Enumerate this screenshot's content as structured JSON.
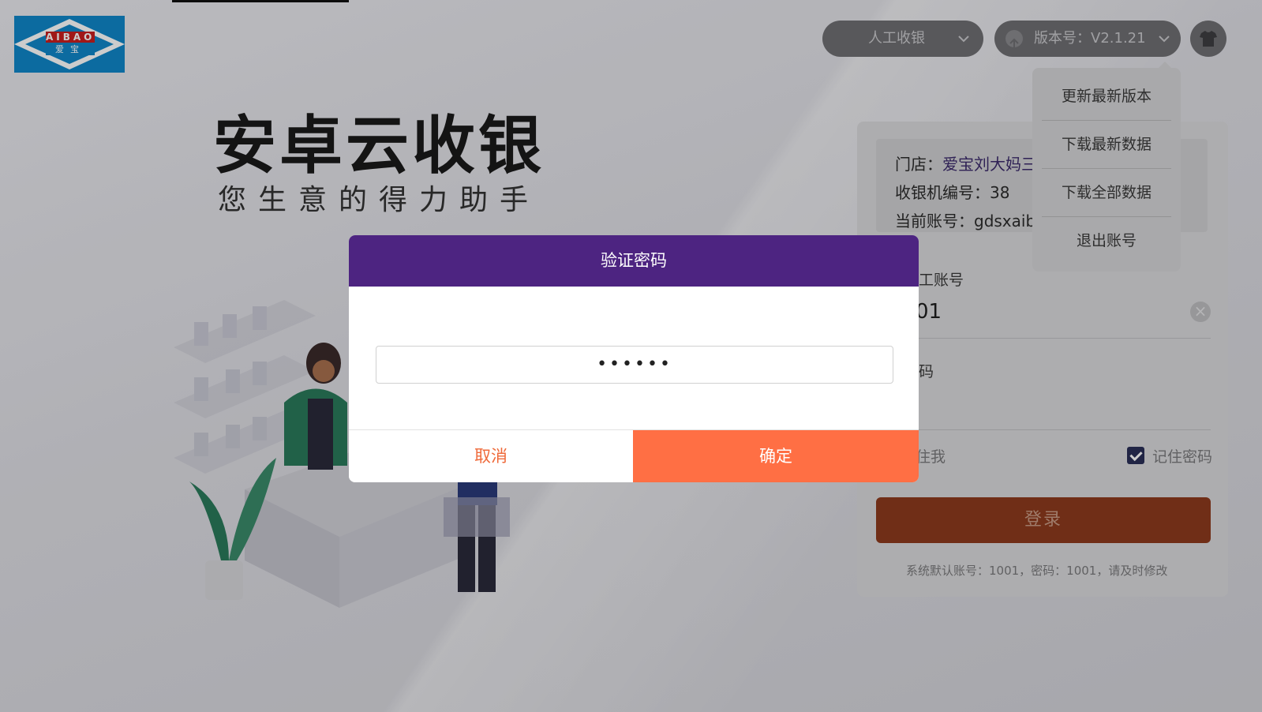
{
  "brand": {
    "logo_text": "AIBAO",
    "logo_sub": "爱宝",
    "hero_title": "安卓云收银",
    "hero_subtitle": "您生意的得力助手"
  },
  "topbar": {
    "mode_label": "人工收银",
    "version_label": "版本号：V2.1.21"
  },
  "version_menu": {
    "items": [
      "更新最新版本",
      "下载最新数据",
      "下载全部数据",
      "退出账号"
    ]
  },
  "login_card": {
    "store_prefix": "门店：",
    "store_value": "爱宝刘大妈三",
    "register_label": "收银机编号：38",
    "account_label": "当前账号：gdsxaib",
    "employee_label": "工账号",
    "employee_value": "01",
    "password_label": "码",
    "remember_me": "住我",
    "remember_password": "记住密码",
    "remember_password_checked": true,
    "login_button": "登录",
    "hint": "系统默认账号：1001，密码：1001，请及时修改"
  },
  "dialog": {
    "title": "验证密码",
    "password_value": "••••••",
    "cancel_label": "取消",
    "confirm_label": "确定"
  },
  "colors": {
    "dialog_header": "#4d2481",
    "confirm_button": "#ff6f44",
    "cancel_text": "#ef6a3a"
  }
}
